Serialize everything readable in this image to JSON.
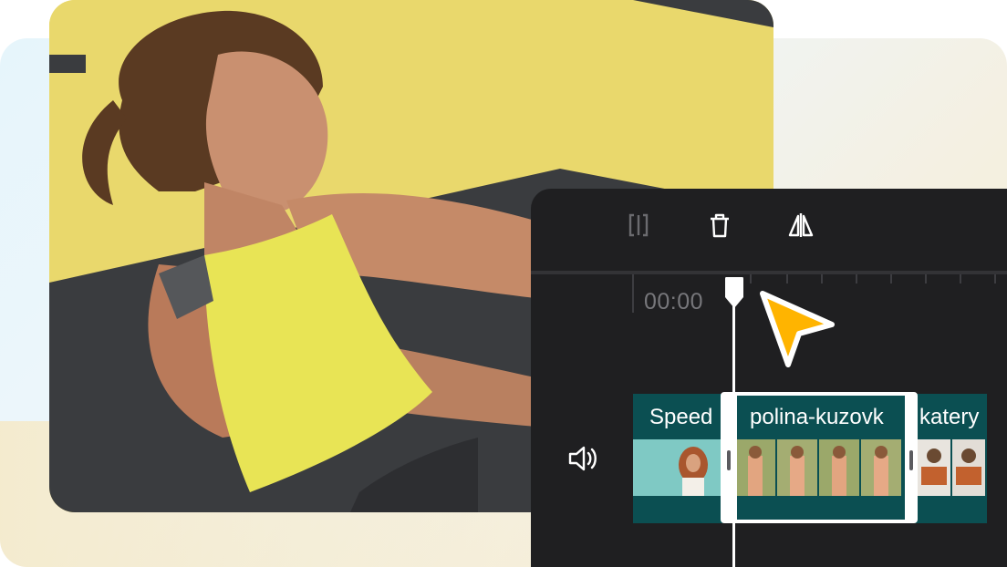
{
  "hero_image": {
    "icon": "fitness-woman-photo"
  },
  "toolbar": {
    "split_icon": "split-icon",
    "delete_icon": "trash-icon",
    "flip_icon": "flip-icon"
  },
  "timeline": {
    "timecode": "00:00",
    "volume_icon": "speaker-icon",
    "clips": [
      {
        "label": "Speed"
      },
      {
        "label": "polina-kuzovk"
      },
      {
        "label": "katery"
      }
    ]
  },
  "colors": {
    "editor_bg": "#1f1f21",
    "clip_teal": "#0b4f52",
    "cursor_yellow": "#ffb400",
    "photo_yellow": "#e9d86c"
  }
}
